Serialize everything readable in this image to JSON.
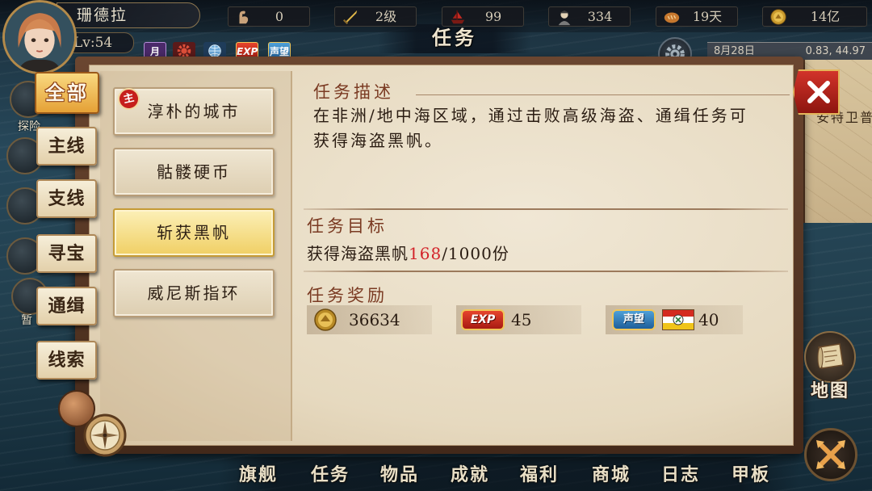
{
  "player": {
    "name": "珊德拉",
    "level": "Lv:54",
    "avatar_icon": "player-portrait"
  },
  "resources": [
    {
      "icon": "strength-icon",
      "value": "0"
    },
    {
      "icon": "sword-icon",
      "value": "2级"
    },
    {
      "icon": "pirate-ship-icon",
      "value": "99"
    },
    {
      "icon": "sailor-icon",
      "value": "334"
    },
    {
      "icon": "bread-icon",
      "value": "19天"
    },
    {
      "icon": "gold-coin-icon",
      "value": "14亿"
    }
  ],
  "quick_icons": [
    {
      "icon": "moon-icon",
      "label": "月"
    },
    {
      "icon": "gear-icon"
    },
    {
      "icon": "globe-icon"
    },
    {
      "icon": "exp-badge-icon",
      "label": "EXP"
    },
    {
      "icon": "reputation-badge-icon",
      "label": "声望"
    }
  ],
  "window_title": "任务",
  "status": {
    "date": "8月28日",
    "coords": "0.83, 44.97"
  },
  "background_buttons": [
    {
      "label": "探险"
    },
    {
      "label": "暂"
    }
  ],
  "categories": [
    {
      "label": "全部",
      "selected": true
    },
    {
      "label": "主线",
      "selected": false
    },
    {
      "label": "支线",
      "selected": false
    },
    {
      "label": "寻宝",
      "selected": false
    },
    {
      "label": "通缉",
      "selected": false
    },
    {
      "label": "线索",
      "selected": false
    }
  ],
  "tasks": [
    {
      "name": "淳朴的城市",
      "badge": "主",
      "selected": false
    },
    {
      "name": "骷髅硬币",
      "selected": false
    },
    {
      "name": "斩获黑帆",
      "selected": true
    },
    {
      "name": "威尼斯指环",
      "selected": false
    }
  ],
  "detail": {
    "description_title": "任务描述",
    "description_lines": [
      "在非洲/地中海区域，通过击败高级海盗、通缉任务可",
      "获得海盗黑帆。"
    ],
    "objective_title": "任务目标",
    "objective": {
      "text": "获得海盗黑帆",
      "progress": "168",
      "total": "/1000份"
    },
    "reward_title": "任务奖励",
    "rewards": [
      {
        "icon": "gold-coin-icon",
        "value": "36634"
      },
      {
        "icon": "exp-badge-icon",
        "label": "EXP",
        "value": "45"
      },
      {
        "icon": "reputation-badge-icon",
        "label": "声望",
        "flag_icon": "nation-flag-icon",
        "value": "40"
      }
    ]
  },
  "map_preview": {
    "place": "安特卫普"
  },
  "map_button": {
    "label": "地图",
    "icon": "map-scroll-icon"
  },
  "action_button": {
    "icon": "crossed-arrows-icon"
  },
  "close_button": {
    "icon": "close-icon"
  },
  "bottom_nav": [
    "旗舰",
    "任务",
    "物品",
    "成就",
    "福利",
    "商城",
    "日志",
    "甲板"
  ],
  "colors": {
    "header_brown": "#7a3a22",
    "progress_red": "#d3232a",
    "selected_gold": "#f0cf64",
    "parchment": "#e6d9bf",
    "close_red": "#c8281f"
  }
}
